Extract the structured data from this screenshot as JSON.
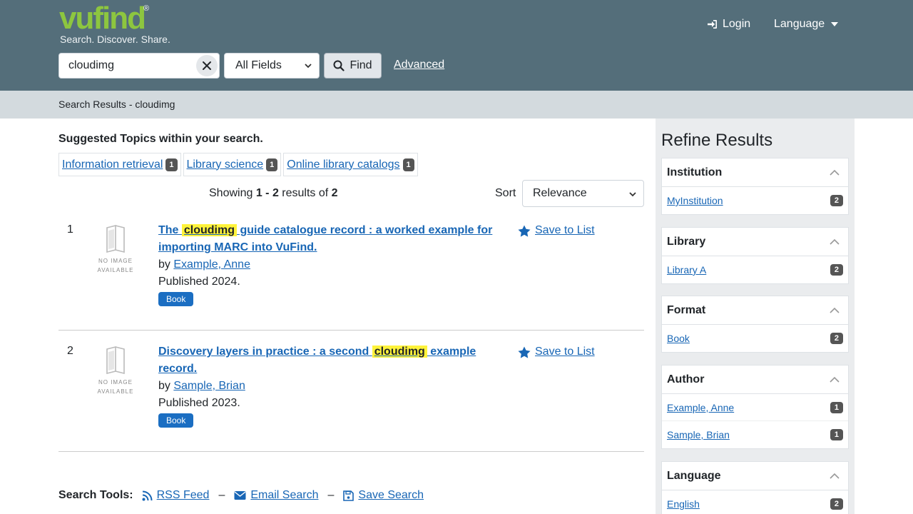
{
  "header": {
    "logo_text": "vufind",
    "logo_reg": "®",
    "tagline": "Search. Discover. Share.",
    "login": "Login",
    "language": "Language"
  },
  "search": {
    "query": "cloudimg",
    "field": "All Fields",
    "find_label": "Find",
    "advanced_label": "Advanced"
  },
  "breadcrumb": "Search Results - cloudimg",
  "suggested": {
    "title": "Suggested Topics within your search.",
    "topics": [
      {
        "label": "Information retrieval",
        "count": "1"
      },
      {
        "label": "Library science",
        "count": "1"
      },
      {
        "label": "Online library catalogs",
        "count": "1"
      }
    ]
  },
  "summary": {
    "prefix": "Showing ",
    "range": "1 - 2",
    "mid": " results of ",
    "total": "2"
  },
  "sort": {
    "label": "Sort",
    "value": "Relevance"
  },
  "results": [
    {
      "num": "1",
      "title_before": "The ",
      "title_highlight": "cloudimg",
      "title_after": " guide catalogue record : a worked example for importing MARC into VuFind.",
      "by": "by ",
      "author": "Example, Anne",
      "published": "Published 2024.",
      "format": "Book",
      "save": "Save to List",
      "noimg": "NO IMAGE AVAILABLE"
    },
    {
      "num": "2",
      "title_before": "Discovery layers in practice : a second ",
      "title_highlight": "cloudimg",
      "title_after": " example record.",
      "by": "by ",
      "author": "Sample, Brian",
      "published": "Published 2023.",
      "format": "Book",
      "save": "Save to List",
      "noimg": "NO IMAGE AVAILABLE"
    }
  ],
  "tools": {
    "label": "Search Tools:",
    "rss": "RSS Feed",
    "email": "Email Search",
    "save": "Save Search",
    "sep": "–"
  },
  "sidebar": {
    "title": "Refine Results",
    "facets": [
      {
        "name": "Institution",
        "items": [
          {
            "label": "MyInstitution",
            "count": "2"
          }
        ]
      },
      {
        "name": "Library",
        "items": [
          {
            "label": "Library A",
            "count": "2"
          }
        ]
      },
      {
        "name": "Format",
        "items": [
          {
            "label": "Book",
            "count": "2"
          }
        ]
      },
      {
        "name": "Author",
        "items": [
          {
            "label": "Example, Anne",
            "count": "1"
          },
          {
            "label": "Sample, Brian",
            "count": "1"
          }
        ]
      },
      {
        "name": "Language",
        "items": [
          {
            "label": "English",
            "count": "2"
          }
        ]
      }
    ]
  },
  "colors": {
    "header_bg": "#546e7a",
    "logo_green": "#8dc63f",
    "link": "#1866b5",
    "highlight": "#fff33a",
    "format_badge": "#1b6ec2"
  }
}
